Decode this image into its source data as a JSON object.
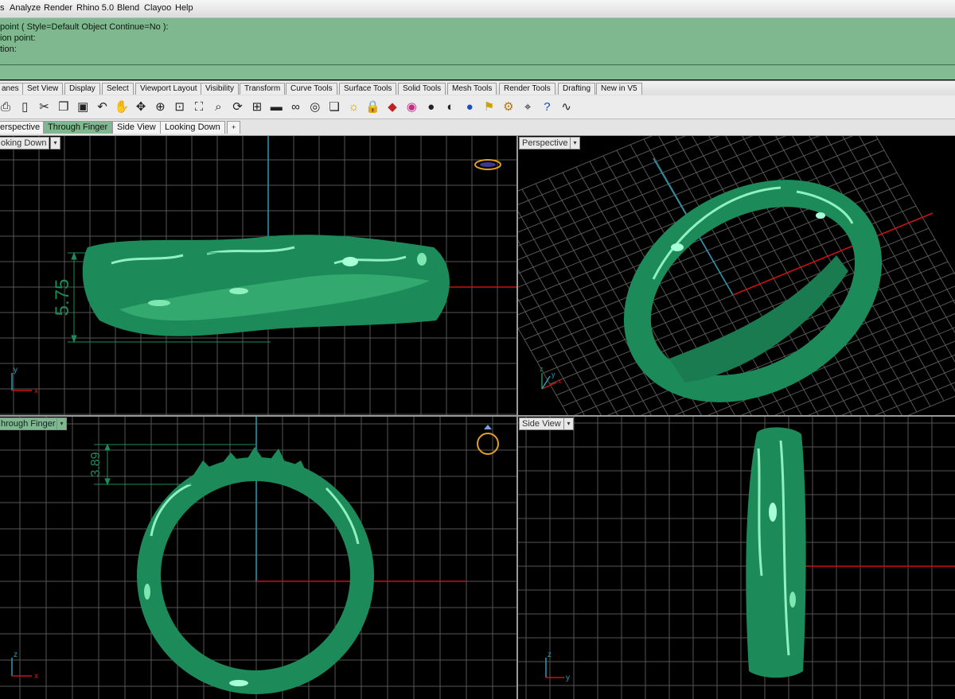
{
  "menu": {
    "items": [
      "s",
      "Analyze",
      "Render",
      "Rhino 5.0",
      "Blend",
      "Clayoo",
      "Help"
    ]
  },
  "command": {
    "line1": "point ( Style=Default  Object  Continue=No ):",
    "line2": "ion point:",
    "line3": "tion:"
  },
  "toolbar_tabs": [
    "anes",
    "Set View",
    "Display",
    "Select",
    "Viewport Layout",
    "Visibility",
    "Transform",
    "Curve Tools",
    "Surface Tools",
    "Solid Tools",
    "Mesh Tools",
    "Render Tools",
    "Drafting",
    "New in V5"
  ],
  "toolbar_icons": [
    "print-icon",
    "page-icon",
    "cut-icon",
    "copy-icon",
    "paste-icon",
    "undo-icon",
    "pan-hand-icon",
    "move-icon",
    "zoom-icon",
    "zoom-window-icon",
    "zoom-extents-icon",
    "zoom-selected-icon",
    "rotate-view-icon",
    "four-viewports-icon",
    "car-icon",
    "glasses-icon",
    "target-icon",
    "layers-icon",
    "light-icon",
    "lock-icon",
    "material-icon",
    "color-wheel-icon",
    "sphere-shaded-icon",
    "sphere-render-icon",
    "sphere-blue-icon",
    "flag-icon",
    "gear-icon",
    "snap-icon",
    "help-icon",
    "curve-icon"
  ],
  "viewport_tabs": [
    "erspective",
    "Through Finger",
    "Side View",
    "Looking Down",
    "+"
  ],
  "viewports": {
    "top_left": {
      "label": "oking Down",
      "dimension": "5.75",
      "axis_x": "x",
      "axis_y": "y"
    },
    "top_right": {
      "label": "Perspective",
      "axis_x": "x",
      "axis_y": "y",
      "axis_z": "z"
    },
    "bottom_left": {
      "label": "hrough Finger",
      "dimension": "3.89",
      "axis_x": "x",
      "axis_z": "z"
    },
    "bottom_right": {
      "label": "Side View",
      "axis_y": "y",
      "axis_z": "z"
    }
  },
  "colors": {
    "model": "#1d8a5a",
    "model_highlight": "#6fe0a8",
    "dimension": "#1d8a5a",
    "grid": "#6a6a6a",
    "axis_x": "#d01010",
    "axis_y": "#2a9ab0",
    "command_bg": "#7fb88e"
  }
}
